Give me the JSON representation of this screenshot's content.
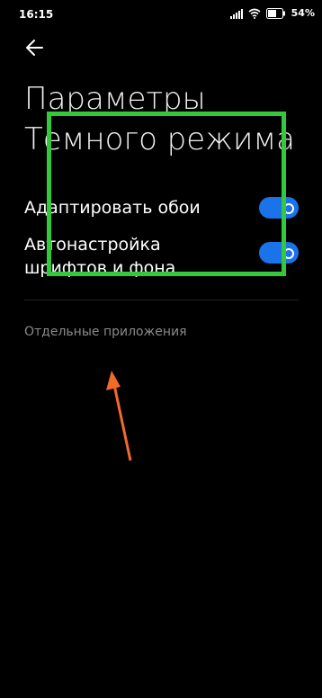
{
  "status": {
    "time": "16:15",
    "battery": "54"
  },
  "page": {
    "title": "Параметры Темного режима"
  },
  "settings": [
    {
      "label": "Адаптировать обои",
      "enabled": true
    },
    {
      "label": "Автонастройка шрифтов и фона",
      "enabled": true
    }
  ],
  "section": {
    "link": "Отдельные приложения"
  },
  "colors": {
    "accent": "#1a73e8",
    "highlight": "#34c93a",
    "arrow": "#f26a28"
  }
}
